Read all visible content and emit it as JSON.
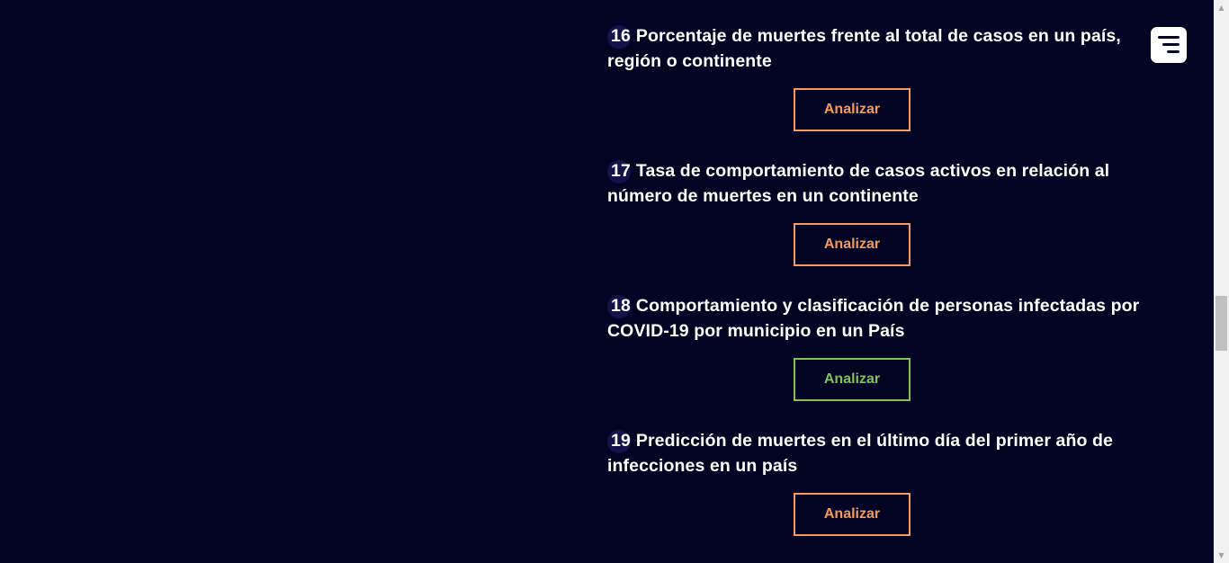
{
  "items": [
    {
      "number": "16",
      "title": "Porcentaje de muertes frente al total de casos en un país, región o continente",
      "button_label": "Analizar",
      "button_state": "default"
    },
    {
      "number": "17",
      "title": "Tasa de comportamiento de casos activos en relación al número de muertes en un continente",
      "button_label": "Analizar",
      "button_state": "default"
    },
    {
      "number": "18",
      "title": "Comportamiento y clasificación de personas infectadas por COVID-19 por municipio en un País",
      "button_label": "Analizar",
      "button_state": "hover"
    },
    {
      "number": "19",
      "title": "Predicción de muertes en el último día del primer año de infecciones en un país",
      "button_label": "Analizar",
      "button_state": "default"
    }
  ],
  "menu": {
    "icon": "hamburger-menu-icon"
  },
  "colors": {
    "background": "#030424",
    "accent": "#f59a5c",
    "active": "#7fc35b",
    "text": "#ffffff",
    "number_badge": "#11134a"
  }
}
